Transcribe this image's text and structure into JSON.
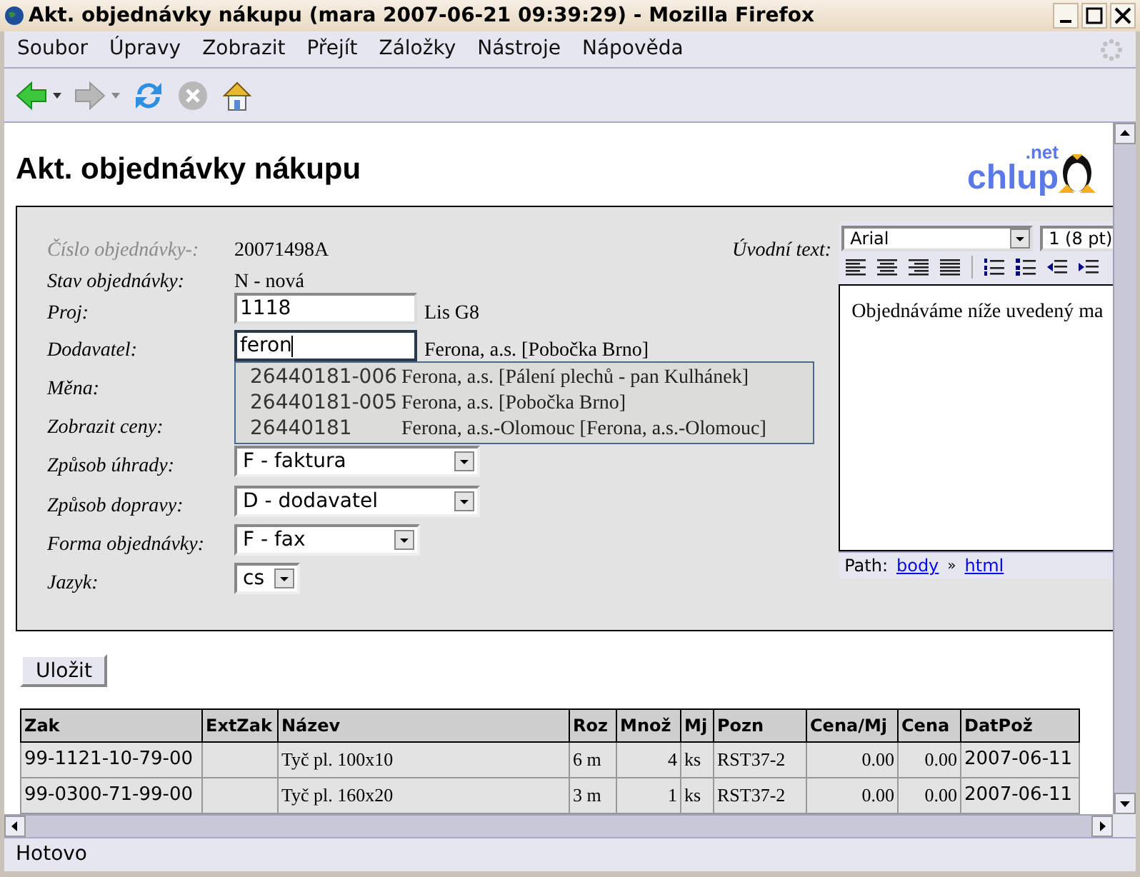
{
  "window": {
    "title": "Akt. objednávky nákupu (mara 2007-06-21 09:39:29) - Mozilla Firefox"
  },
  "menu": [
    "Soubor",
    "Úpravy",
    "Zobrazit",
    "Přejít",
    "Záložky",
    "Nástroje",
    "Nápověda"
  ],
  "toolbar": [
    {
      "kind": "back",
      "disabled": false
    },
    {
      "kind": "forward",
      "disabled": true
    },
    {
      "kind": "reload",
      "disabled": false
    },
    {
      "kind": "stop",
      "disabled": true
    },
    {
      "kind": "home",
      "disabled": false
    }
  ],
  "page": {
    "heading": "Akt. objednávky nákupu",
    "logo": {
      "name": "chlup",
      "suffix": ".net"
    }
  },
  "form": {
    "fields": [
      {
        "label": "Číslo objednávky-:",
        "dimmed": true,
        "kind": "text",
        "value": "20071498A"
      },
      {
        "label": "Stav objednávky:",
        "dimmed": false,
        "kind": "text",
        "value": "N - nová"
      },
      {
        "label": "Proj:",
        "dimmed": false,
        "kind": "input",
        "value": "1118",
        "note": "Lis G8",
        "focused": false
      },
      {
        "label": "Dodavatel:",
        "dimmed": false,
        "kind": "input",
        "value": "feron",
        "note": "Ferona, a.s. [Pobočka Brno]",
        "focused": true
      },
      {
        "label": "Měna:",
        "dimmed": false,
        "kind": "hidden"
      },
      {
        "label": "Zobrazit ceny:",
        "dimmed": false,
        "kind": "hidden"
      },
      {
        "label": "Způsob úhrady:",
        "dimmed": false,
        "kind": "select",
        "value": "F - faktura"
      },
      {
        "label": "Způsob dopravy:",
        "dimmed": false,
        "kind": "select",
        "value": "D - dodavatel"
      },
      {
        "label": "Forma objednávky:",
        "dimmed": false,
        "kind": "select",
        "value": "F - fax"
      },
      {
        "label": "Jazyk:",
        "dimmed": false,
        "kind": "select",
        "value": "cs"
      }
    ],
    "suggestions": [
      {
        "code": "26440181-006",
        "name": "Ferona, a.s. [Pálení plechů - pan Kulhánek]"
      },
      {
        "code": "26440181-005",
        "name": "Ferona, a.s. [Pobočka Brno]"
      },
      {
        "code": "26440181",
        "name": "Ferona, a.s.-Olomouc [Ferona, a.s.-Olomouc]"
      }
    ],
    "editor": {
      "label": "Úvodní text:",
      "font": "Arial",
      "size": "1 (8 pt)",
      "text": "Objednáváme níže uvedený ma",
      "path_label": "Path:",
      "path": [
        "body",
        "html"
      ],
      "path_separator": "»"
    },
    "save_button": "Uložit"
  },
  "table": {
    "columns": [
      {
        "label": "Zak",
        "numeric": false
      },
      {
        "label": "ExtZak"
      },
      {
        "label": "Název",
        "numeric": false
      },
      {
        "label": "Roz",
        "numeric": false
      },
      {
        "label": "Množ",
        "numeric": true
      },
      {
        "label": "Mj",
        "numeric": false
      },
      {
        "label": "Pozn",
        "numeric": false
      },
      {
        "label": "Cena/Mj",
        "numeric": true
      },
      {
        "label": "Cena",
        "numeric": true
      },
      {
        "label": "DatPož",
        "numeric": false
      }
    ],
    "rows": [
      [
        "99-1121-10-79-00",
        "",
        "Tyč pl. 100x10",
        "6 m",
        "4",
        "ks",
        "RST37-2",
        "0.00",
        "0.00",
        "2007-06-11"
      ],
      [
        "99-0300-71-99-00",
        "",
        "Tyč pl. 160x20",
        "3 m",
        "1",
        "ks",
        "RST37-2",
        "0.00",
        "0.00",
        "2007-06-11"
      ]
    ]
  },
  "status_bar": "Hotovo"
}
